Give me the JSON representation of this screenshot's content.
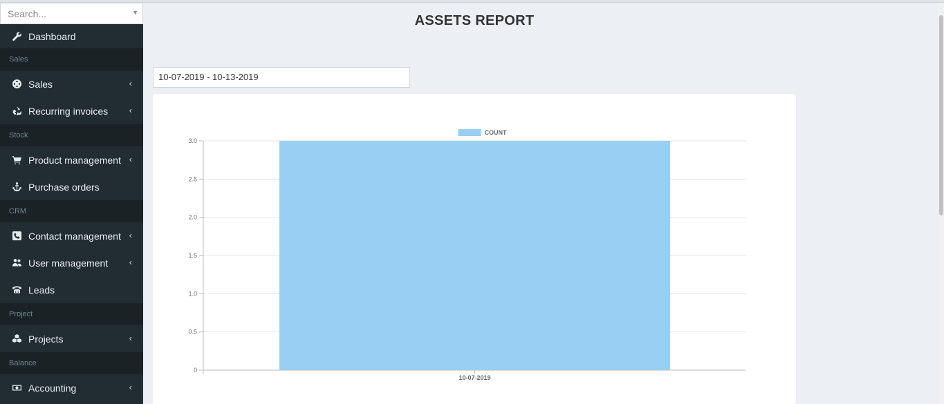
{
  "search": {
    "placeholder": "Search..."
  },
  "sidebar": {
    "items": [
      {
        "type": "item",
        "label": "Dashboard",
        "icon": "wrench-icon",
        "chevron": false
      },
      {
        "type": "header",
        "label": "Sales"
      },
      {
        "type": "item",
        "label": "Sales",
        "icon": "life-ring-icon",
        "chevron": true
      },
      {
        "type": "item",
        "label": "Recurring invoices",
        "icon": "recycle-icon",
        "chevron": true
      },
      {
        "type": "header",
        "label": "Stock"
      },
      {
        "type": "item",
        "label": "Product management",
        "icon": "cart-icon",
        "chevron": true
      },
      {
        "type": "item",
        "label": "Purchase orders",
        "icon": "anchor-icon",
        "chevron": false
      },
      {
        "type": "header",
        "label": "CRM"
      },
      {
        "type": "item",
        "label": "Contact management",
        "icon": "phone-square-icon",
        "chevron": true
      },
      {
        "type": "item",
        "label": "User management",
        "icon": "users-icon",
        "chevron": true
      },
      {
        "type": "item",
        "label": "Leads",
        "icon": "fax-icon",
        "chevron": false
      },
      {
        "type": "header",
        "label": "Project"
      },
      {
        "type": "item",
        "label": "Projects",
        "icon": "cubes-icon",
        "chevron": true
      },
      {
        "type": "header",
        "label": "Balance"
      },
      {
        "type": "item",
        "label": "Accounting",
        "icon": "money-icon",
        "chevron": true
      }
    ]
  },
  "page": {
    "title": "ASSETS REPORT"
  },
  "date_range": {
    "value": "10-07-2019 - 10-13-2019"
  },
  "colors": {
    "sidebar_bg": "#222d32",
    "bar_fill": "#99cff3",
    "legend_fill": "#99cff3"
  },
  "chart_data": {
    "type": "bar",
    "categories": [
      "10-07-2019"
    ],
    "series": [
      {
        "name": "COUNT",
        "values": [
          3
        ]
      }
    ],
    "ylim": [
      0,
      3
    ],
    "yticks": [
      "0",
      "0.5",
      "1.0",
      "1.5",
      "2.0",
      "2.5",
      "3.0"
    ],
    "grid": true,
    "legend": "top"
  }
}
